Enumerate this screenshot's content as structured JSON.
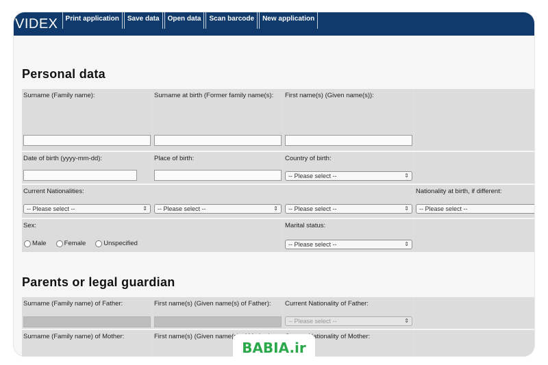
{
  "app": {
    "logo": "VIDEX"
  },
  "menu": [
    "Print application",
    "Save data",
    "Open data",
    "Scan barcode",
    "New application"
  ],
  "personal": {
    "title": "Personal data",
    "surname": "Surname (Family name):",
    "surname_birth": "Surname at birth (Former family name(s):",
    "first_names": "First name(s) (Given name(s)):",
    "dob": "Date of birth (yyyy-mm-dd):",
    "place_birth": "Place of birth:",
    "country_birth": "Country of birth:",
    "current_nationalities": "Current Nationalities:",
    "nationality_birth": "Nationality at birth, if different:",
    "sex": "Sex:",
    "sex_options": [
      "Male",
      "Female",
      "Unspecified"
    ],
    "marital": "Marital status:",
    "select_placeholder": "-- Please select --"
  },
  "parents": {
    "title": "Parents or legal guardian",
    "father_surname": "Surname (Family name) of Father:",
    "father_first": "First name(s) (Given name(s) of Father):",
    "father_nationality": "Current Nationality of Father:",
    "mother_surname": "Surname (Family name) of Mother:",
    "mother_first": "First name(s) (Given name(s) of Mother):",
    "mother_nationality": "Current Nationality of Mother:"
  },
  "watermark": {
    "text": "BABIA.ir"
  }
}
